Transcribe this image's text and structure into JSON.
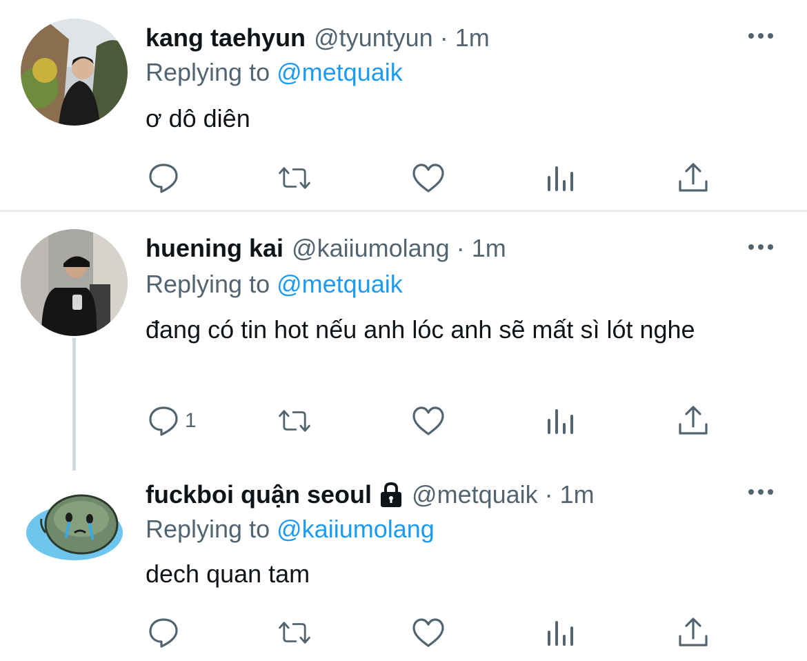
{
  "tweets": [
    {
      "name": "kang taehyun",
      "handle": "@tyuntyun",
      "separator": "·",
      "time": "1m",
      "replying_prefix": "Replying to",
      "replying_to": "@metquaik",
      "text": "ơ dô diên",
      "reply_count": ""
    },
    {
      "name": "huening kai",
      "handle": "@kaiiumolang",
      "separator": "·",
      "time": "1m",
      "replying_prefix": "Replying to",
      "replying_to": "@metquaik",
      "text": "đang có tin hot nếu anh lóc anh sẽ mất sì lót nghe",
      "reply_count": "1"
    },
    {
      "name": "fuckboi quận seoul",
      "handle": "@metquaik",
      "separator": "·",
      "time": "1m",
      "replying_prefix": "Replying to",
      "replying_to": "@kaiiumolang",
      "text": "dech quan tam",
      "reply_count": ""
    }
  ],
  "icons": [
    "reply-icon",
    "retweet-icon",
    "like-icon",
    "analytics-icon",
    "share-icon",
    "more-icon",
    "lock-icon"
  ],
  "colors": {
    "text": "#0f1419",
    "secondary": "#536471",
    "accent": "#1d9bf0",
    "divider": "#e6ecf0"
  }
}
